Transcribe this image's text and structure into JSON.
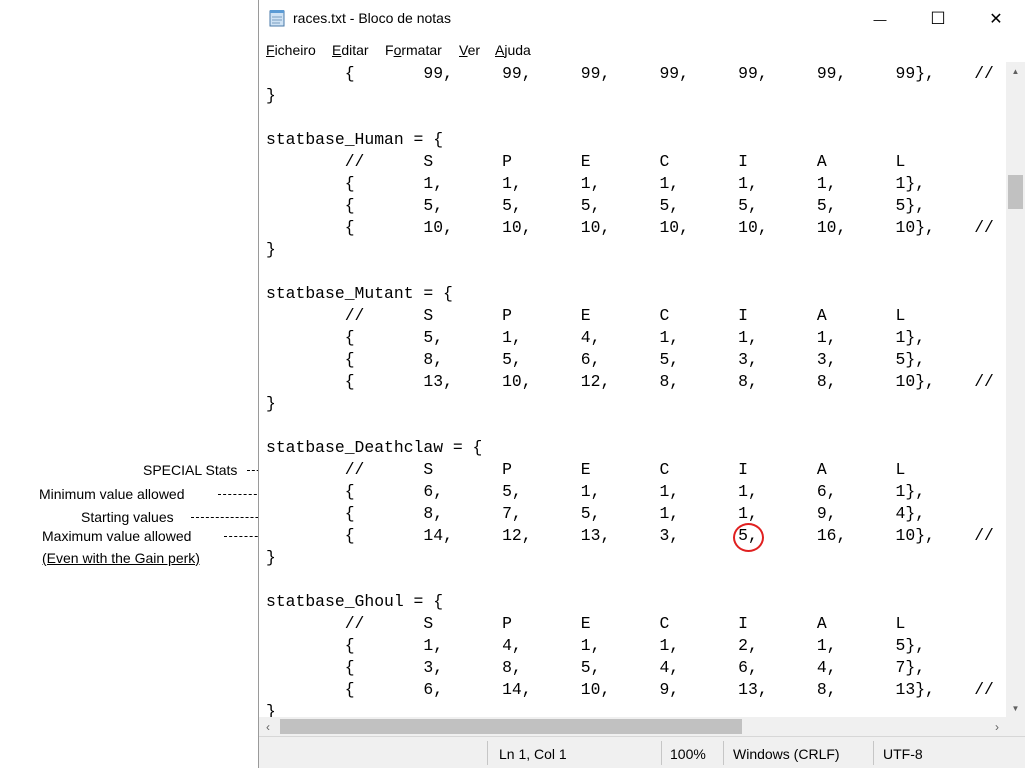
{
  "annotations": [
    {
      "text": "SPECIAL Stats",
      "style": "normal"
    },
    {
      "text": "Minimum value allowed",
      "style": "normal"
    },
    {
      "text": "Starting values",
      "style": "normal"
    },
    {
      "text": "Maximum value allowed",
      "style": "normal"
    },
    {
      "text": "(Even with the Gain perk)",
      "style": "underline"
    }
  ],
  "window": {
    "title": "races.txt - Bloco de notas",
    "controls": {
      "minimize": "—",
      "maximize": "☐",
      "close": "✕"
    },
    "menu": [
      {
        "accel": "F",
        "rest": "icheiro"
      },
      {
        "accel": "E",
        "rest": "ditar"
      },
      {
        "accel": "F",
        "rest": "ormatar",
        "pre": ""
      },
      {
        "accel": "V",
        "rest": "er"
      },
      {
        "accel": "A",
        "rest": "juda"
      }
    ],
    "status": {
      "position": "Ln 1, Col 1",
      "zoom": "100%",
      "line_endings": "Windows (CRLF)",
      "encoding": "UTF-8"
    }
  },
  "editor": {
    "lines": [
      "\t{\t99,\t99,\t99,\t99,\t99,\t99,\t99},\t//",
      "}",
      "",
      "statbase_Human = {",
      "\t//\tS\tP\tE\tC\tI\tA\tL",
      "\t{\t1,\t1,\t1,\t1,\t1,\t1,\t1},",
      "\t{\t5,\t5,\t5,\t5,\t5,\t5,\t5},",
      "\t{\t10,\t10,\t10,\t10,\t10,\t10,\t10},\t//",
      "}",
      "",
      "statbase_Mutant = {",
      "\t//\tS\tP\tE\tC\tI\tA\tL",
      "\t{\t5,\t1,\t4,\t1,\t1,\t1,\t1},",
      "\t{\t8,\t5,\t6,\t5,\t3,\t3,\t5},",
      "\t{\t13,\t10,\t12,\t8,\t8,\t8,\t10},\t//",
      "}",
      "",
      "statbase_Deathclaw = {",
      "\t//\tS\tP\tE\tC\tI\tA\tL",
      "\t{\t6,\t5,\t1,\t1,\t1,\t6,\t1},",
      "\t{\t8,\t7,\t5,\t1,\t1,\t9,\t4},",
      "\t{\t14,\t12,\t13,\t3,\t5,\t16,\t10},\t//",
      "}",
      "",
      "statbase_Ghoul = {",
      "\t//\tS\tP\tE\tC\tI\tA\tL",
      "\t{\t1,\t4,\t1,\t1,\t2,\t1,\t5},",
      "\t{\t3,\t8,\t5,\t4,\t6,\t4,\t7},",
      "\t{\t6,\t14,\t10,\t9,\t13,\t8,\t13},\t//",
      "}"
    ]
  },
  "colors": {
    "highlight_circle": "#e02020",
    "chrome": "#f0f0f0"
  }
}
